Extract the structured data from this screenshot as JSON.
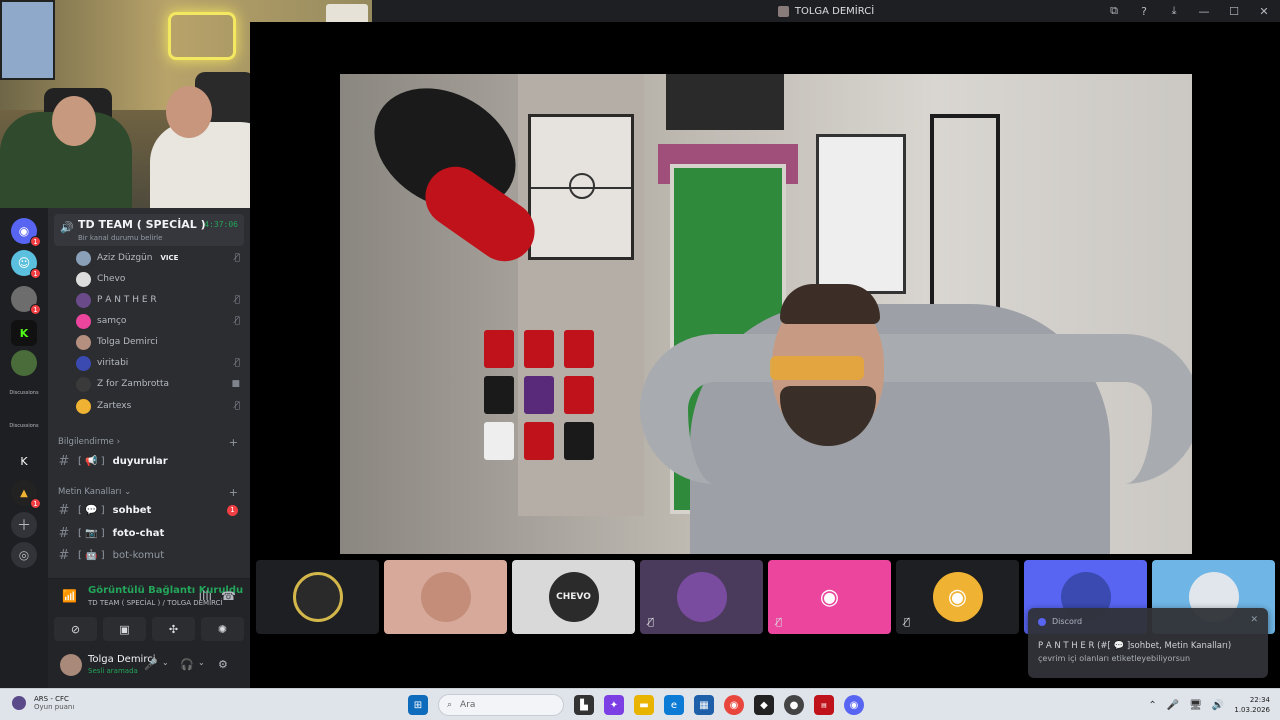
{
  "window": {
    "title": "TOLGA DEMİRCİ",
    "controls": [
      "⧉",
      "?",
      "⤓",
      "—",
      "☐",
      "✕"
    ]
  },
  "servers": [
    {
      "badge": "1",
      "color": "#5865f2"
    },
    {
      "badge": "1",
      "color": "#5bc0de"
    },
    {
      "badge": "1",
      "color": "#6d6d6d"
    },
    {
      "badge": "",
      "color": "#111111"
    },
    {
      "badge": "",
      "color": "#4a6b3a"
    },
    {
      "label": "Discussions"
    },
    {
      "label": "Discussions"
    },
    {
      "letter": "K"
    },
    {
      "badge": "1",
      "color": "#222222"
    }
  ],
  "voice_channel": {
    "name": "TD TEAM ( SPECİAL )",
    "status": "Bir kanal durumu belirle",
    "timer": "4:37:06",
    "members": [
      {
        "name": "Aziz Düzgün",
        "tag": "VICE",
        "icon": "muted",
        "color": "#8aa0b8"
      },
      {
        "name": "Chevo",
        "tag": "",
        "icon": "",
        "color": "#dddddd"
      },
      {
        "name": "P A N T H E R",
        "tag": "",
        "icon": "muted",
        "color": "#6b4a8a"
      },
      {
        "name": "samço",
        "tag": "",
        "icon": "muted",
        "color": "#eb459e"
      },
      {
        "name": "Tolga Demirci",
        "tag": "",
        "icon": "",
        "color": "#b48f7f"
      },
      {
        "name": "viritabi",
        "tag": "",
        "icon": "muted",
        "color": "#3a4ab0"
      },
      {
        "name": "Z for Zambrotta",
        "tag": "",
        "icon": "video",
        "color": "#3a3a3a"
      },
      {
        "name": "Zartexs",
        "tag": "",
        "icon": "muted",
        "color": "#f0b232"
      }
    ]
  },
  "categories": {
    "info": "Bilgilendirme",
    "chat": "Metin Kanalları"
  },
  "text_channels": [
    {
      "name": "duyurular",
      "prefix": "[ 📢 ]",
      "unread": "",
      "dim": false
    },
    {
      "name": "sohbet",
      "prefix": "[ 💬 ]",
      "unread": "1",
      "dim": false
    },
    {
      "name": "foto-chat",
      "prefix": "[ 📷 ]",
      "unread": "",
      "dim": false
    },
    {
      "name": "bot-komut",
      "prefix": "[ 🤖 ]",
      "unread": "",
      "dim": true
    }
  ],
  "voice_panel": {
    "status": "Görüntülü Bağlantı Kuruldu",
    "location": "TD TEAM ( SPECİAL ) / TOLGA DEMİRCİ"
  },
  "user": {
    "name": "Tolga Demirci",
    "status": "Sesli aramada"
  },
  "tiles": [
    {
      "bg": "#1e1f22",
      "circle": "#2a2a2a",
      "mute": ""
    },
    {
      "bg": "#d7a99a",
      "circle": "#c48d7a",
      "mute": ""
    },
    {
      "bg": "#d9d9d9",
      "circle": "#2b2b2b",
      "mute": ""
    },
    {
      "bg": "#4a3a5c",
      "circle": "#7a4ca0",
      "mute": "muted"
    },
    {
      "bg": "#eb459e",
      "circle": "#eb459e",
      "mute": "muted"
    },
    {
      "bg": "#1e1f22",
      "circle": "#f0b232",
      "mute": "muted"
    },
    {
      "bg": "#5865f2",
      "circle": "#3a4ab0",
      "mute": ""
    },
    {
      "bg": "#6fb6e6",
      "circle": "#e0e6ec",
      "mute": ""
    }
  ],
  "notification": {
    "app": "Discord",
    "title": "P A N T H E R (#[ 💬 ]sohbet, Metin Kanalları)",
    "body": "çevrim içi olanları etiketleyebiliyorsun"
  },
  "taskbar": {
    "weather_title": "ARS - CFC",
    "weather_sub": "Oyun puanı",
    "search_placeholder": "Ara",
    "time": "22:34",
    "date": "1.03.2026"
  }
}
